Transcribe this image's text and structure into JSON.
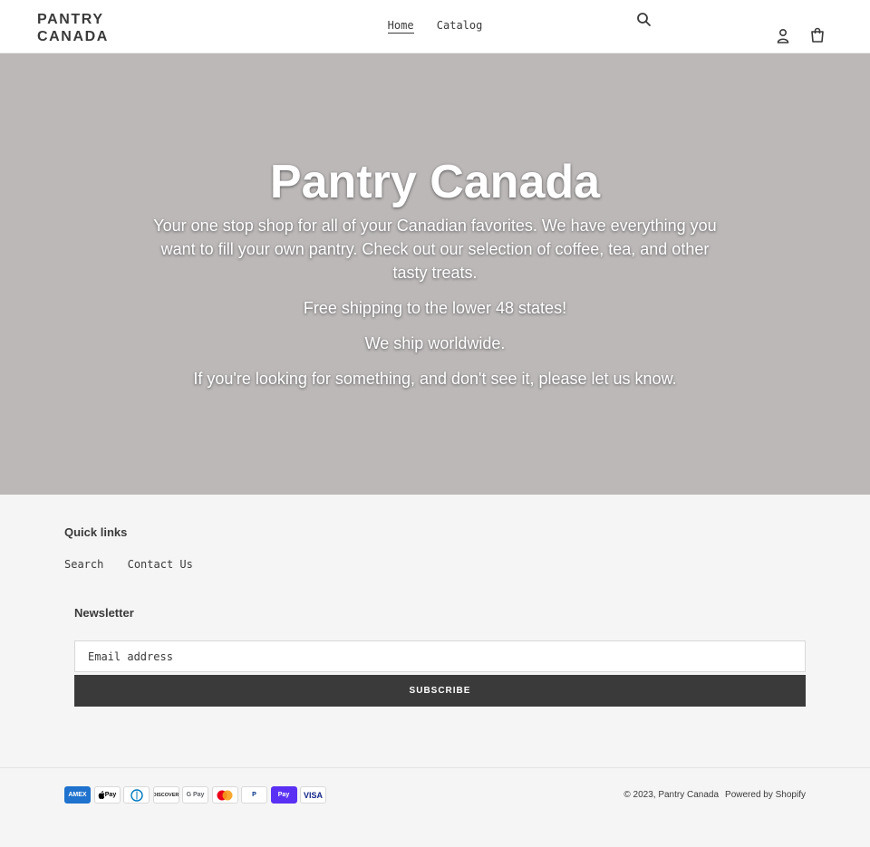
{
  "header": {
    "logo_line1": "PANTRY",
    "logo_line2": "CANADA",
    "nav": [
      {
        "label": "Home"
      },
      {
        "label": "Catalog"
      }
    ],
    "search_icon": "search-icon",
    "login_icon": "user-icon",
    "cart_icon": "cart-icon"
  },
  "hero": {
    "title": "Pantry Canada",
    "paragraphs": [
      "Your one stop shop for all of your Canadian favorites.  We have everything you want to fill your own pantry.  Check out our selection of coffee, tea, and other tasty treats.",
      "Free shipping to the lower 48 states!",
      "We ship worldwide.",
      "If you're looking for something, and don't see it, please let us know."
    ],
    "background_color": "#bcb8b8"
  },
  "footer": {
    "quick_links_title": "Quick links",
    "quick_links": [
      {
        "label": "Search"
      },
      {
        "label": "Contact Us"
      }
    ],
    "newsletter_title": "Newsletter",
    "email_placeholder": "Email address",
    "subscribe_label": "SUBSCRIBE",
    "button_color": "#3a3a3a"
  },
  "bottom": {
    "payments": [
      {
        "name": "amex-icon",
        "label": "AMEX"
      },
      {
        "name": "apple-pay-icon",
        "label": "Pay"
      },
      {
        "name": "diners-club-icon",
        "label": "D"
      },
      {
        "name": "discover-icon",
        "label": "DISCOVER"
      },
      {
        "name": "google-pay-icon",
        "label": "G Pay"
      },
      {
        "name": "mastercard-icon",
        "label": ""
      },
      {
        "name": "paypal-icon",
        "label": "P"
      },
      {
        "name": "shop-pay-icon",
        "label": "Pay"
      },
      {
        "name": "visa-icon",
        "label": "VISA"
      }
    ],
    "copyright": "© 2023, Pantry Canada",
    "powered_by": "Powered by Shopify"
  }
}
